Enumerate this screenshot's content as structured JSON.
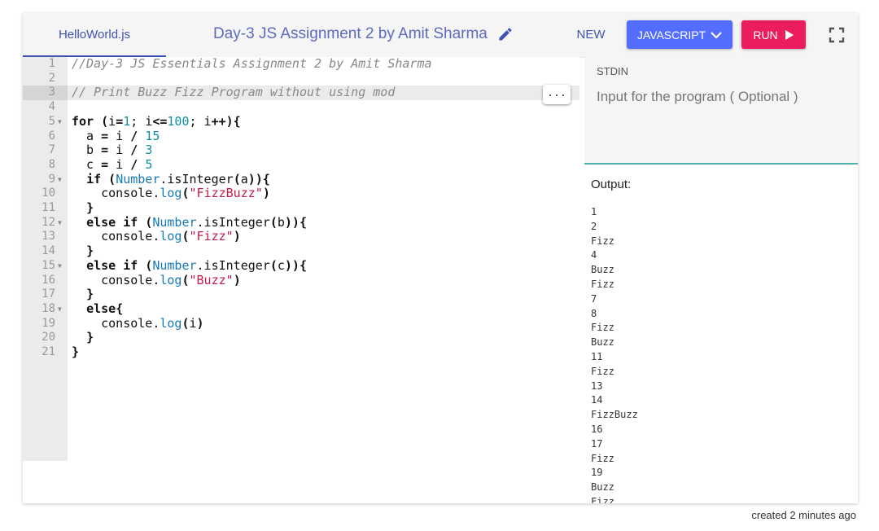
{
  "tab": {
    "label": "HelloWorld.js"
  },
  "title": "Day-3 JS Assignment 2 by Amit Sharma",
  "toolbar": {
    "new_label": "NEW",
    "lang_label": "JAVASCRIPT",
    "run_label": "RUN"
  },
  "editor": {
    "active_line": 3,
    "lines": [
      {
        "n": "1",
        "fold": "",
        "html": "<span class=\"cm\">//Day-3 JS Essentials Assignment 2 by Amit Sharma</span>"
      },
      {
        "n": "2",
        "fold": "",
        "html": ""
      },
      {
        "n": "3",
        "fold": "",
        "html": "<span class=\"cm\">// Print Buzz Fizz Program without using mod</span>"
      },
      {
        "n": "4",
        "fold": "",
        "html": ""
      },
      {
        "n": "5",
        "fold": "▼",
        "html": "<span class=\"kw\">for</span> <span class=\"op\">(</span>i<span class=\"op\">=</span><span class=\"num\">1</span>; i<span class=\"op\">&lt;=</span><span class=\"num\">100</span>; i<span class=\"op\">++){</span>"
      },
      {
        "n": "6",
        "fold": "",
        "html": "  a <span class=\"op\">=</span> i <span class=\"op\">/</span> <span class=\"num\">15</span>"
      },
      {
        "n": "7",
        "fold": "",
        "html": "  b <span class=\"op\">=</span> i <span class=\"op\">/</span> <span class=\"num\">3</span>"
      },
      {
        "n": "8",
        "fold": "",
        "html": "  c <span class=\"op\">=</span> i <span class=\"op\">/</span> <span class=\"num\">5</span>"
      },
      {
        "n": "9",
        "fold": "▼",
        "html": "  <span class=\"kw\">if</span> <span class=\"op\">(</span><span class=\"fn\">Number</span>.isInteger<span class=\"op\">(</span>a<span class=\"op\">)){</span>"
      },
      {
        "n": "10",
        "fold": "",
        "html": "    console.<span class=\"fn\">log</span><span class=\"op\">(</span><span class=\"str\">\"FizzBuzz\"</span><span class=\"op\">)</span>"
      },
      {
        "n": "11",
        "fold": "",
        "html": "  <span class=\"op\">}</span>"
      },
      {
        "n": "12",
        "fold": "▼",
        "html": "  <span class=\"kw\">else if</span> <span class=\"op\">(</span><span class=\"fn\">Number</span>.isInteger<span class=\"op\">(</span>b<span class=\"op\">)){</span>"
      },
      {
        "n": "13",
        "fold": "",
        "html": "    console.<span class=\"fn\">log</span><span class=\"op\">(</span><span class=\"str\">\"Fizz\"</span><span class=\"op\">)</span>"
      },
      {
        "n": "14",
        "fold": "",
        "html": "  <span class=\"op\">}</span>"
      },
      {
        "n": "15",
        "fold": "▼",
        "html": "  <span class=\"kw\">else if</span> <span class=\"op\">(</span><span class=\"fn\">Number</span>.isInteger<span class=\"op\">(</span>c<span class=\"op\">)){</span>"
      },
      {
        "n": "16",
        "fold": "",
        "html": "    console.<span class=\"fn\">log</span><span class=\"op\">(</span><span class=\"str\">\"Buzz\"</span><span class=\"op\">)</span>"
      },
      {
        "n": "17",
        "fold": "",
        "html": "  <span class=\"op\">}</span>"
      },
      {
        "n": "18",
        "fold": "▼",
        "html": "  <span class=\"kw\">else</span><span class=\"op\">{</span>"
      },
      {
        "n": "19",
        "fold": "",
        "html": "    console.<span class=\"fn\">log</span><span class=\"op\">(</span>i<span class=\"op\">)</span>"
      },
      {
        "n": "20",
        "fold": "",
        "html": "  <span class=\"op\">}</span>"
      },
      {
        "n": "21",
        "fold": "",
        "html": "<span class=\"op\">}</span>"
      }
    ]
  },
  "stdin": {
    "label": "STDIN",
    "placeholder": "Input for the program ( Optional )"
  },
  "output": {
    "label": "Output:",
    "lines": [
      "1",
      "2",
      "Fizz",
      "4",
      "Buzz",
      "Fizz",
      "7",
      "8",
      "Fizz",
      "Buzz",
      "11",
      "Fizz",
      "13",
      "14",
      "FizzBuzz",
      "16",
      "17",
      "Fizz",
      "19",
      "Buzz",
      "Fizz"
    ]
  },
  "footer": "created 2 minutes ago",
  "colors": {
    "accent": "#3f51b5",
    "lang_button": "#536dfe",
    "run_button": "#ec1d5e",
    "stdin_border": "#4db6ac"
  }
}
